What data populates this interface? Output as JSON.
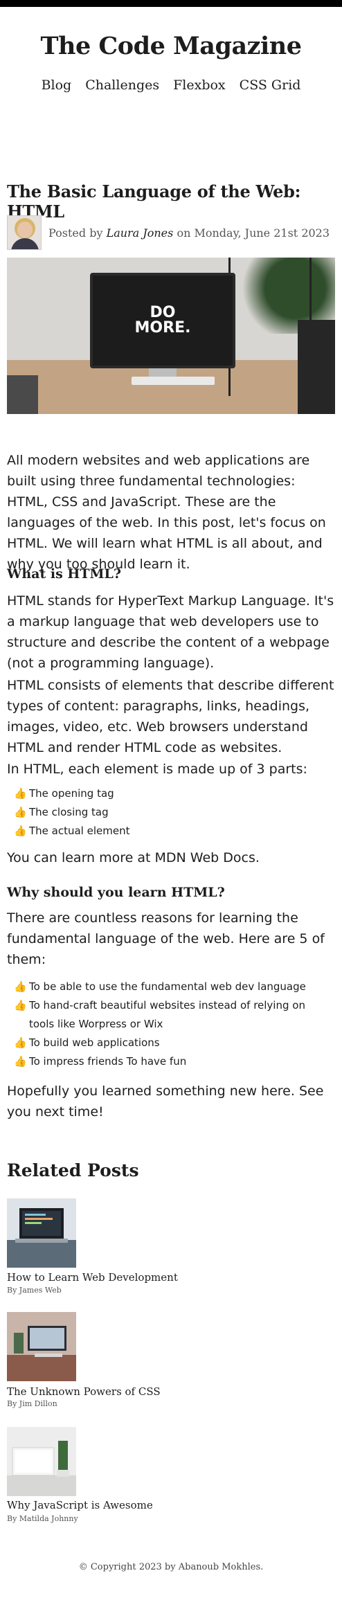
{
  "site": {
    "title": "The Code Magazine"
  },
  "nav": [
    "Blog",
    "Challenges",
    "Flexbox",
    "CSS Grid"
  ],
  "post": {
    "title": "The Basic Language of the Web: HTML",
    "posted_by_prefix": "Posted by",
    "author": "Laura Jones",
    "date_text": "on Monday, June 21st 2023",
    "hero_text": [
      "DO",
      "MORE."
    ],
    "intro": "All modern websites and web applications are built using three fundamental technologies: HTML, CSS and JavaScript. These are the languages of the web. In this post, let's focus on HTML. We will learn what HTML is all about, and why you too should learn it.",
    "section1_heading": "What is HTML?",
    "section1_p1": "HTML stands for HyperText Markup Language. It's a markup language that web developers use to structure and describe the content of a webpage (not a programming language).",
    "section1_p2": "HTML consists of elements that describe different types of content: paragraphs, links, headings, images, video, etc. Web browsers understand HTML and render HTML code as websites.",
    "section1_p3": "In HTML, each element is made up of 3 parts:",
    "parts": [
      "The opening tag",
      "The closing tag",
      "The actual element"
    ],
    "learn_more_prefix": "You can learn more at",
    "learn_more_link": "MDN Web Docs.",
    "section2_heading": "Why should you learn HTML?",
    "section2_p1": "There are countless reasons for learning the fundamental language of the web. Here are 5 of them:",
    "reasons": [
      "To be able to use the fundamental web dev language",
      "To hand-craft beautiful websites instead of relying on tools like Worpress or Wix",
      "To build web applications",
      "To impress friends To have fun"
    ],
    "outro": "Hopefully you learned something new here. See you next time!"
  },
  "related": {
    "heading": "Related Posts",
    "items": [
      {
        "title": "How to Learn Web Development",
        "author": "By James Web"
      },
      {
        "title": "The Unknown Powers of CSS",
        "author": "By Jim Dillon"
      },
      {
        "title": "Why JavaScript is Awesome",
        "author": "By Matilda Johnny"
      }
    ]
  },
  "footer": {
    "text": "© Copyright 2023 by Abanoub Mokhles."
  },
  "icons": {
    "list_bullet": "thumbs-up-icon"
  }
}
